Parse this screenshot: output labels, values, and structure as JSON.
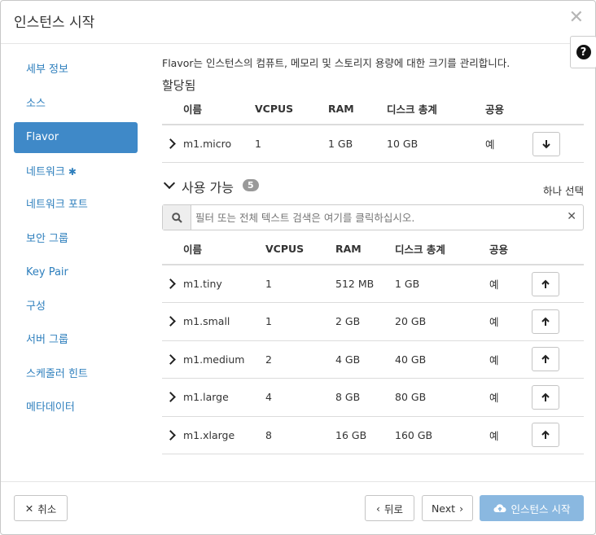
{
  "modal": {
    "title": "인스턴스 시작"
  },
  "nav": {
    "items": [
      {
        "label": "세부 정보"
      },
      {
        "label": "소스"
      },
      {
        "label": "Flavor"
      },
      {
        "label": "네트워크",
        "required": "✱"
      },
      {
        "label": "네트워크 포트"
      },
      {
        "label": "보안 그룹"
      },
      {
        "label": "Key Pair"
      },
      {
        "label": "구성"
      },
      {
        "label": "서버 그룹"
      },
      {
        "label": "스케줄러 힌트"
      },
      {
        "label": "메타데이터"
      }
    ]
  },
  "content": {
    "intro": "Flavor는 인스턴스의 컴퓨트, 메모리 및 스토리지 용량에 대한 크기를 관리합니다.",
    "allocated_title": "할당됨",
    "columns": [
      "이름",
      "VCPUS",
      "RAM",
      "디스크 총계",
      "공용"
    ],
    "allocated_rows": [
      {
        "name": "m1.micro",
        "vcpus": "1",
        "ram": "1 GB",
        "disk": "10 GB",
        "public": "예"
      }
    ],
    "available_title": "사용 가능",
    "available_count": "5",
    "select_one": "하나 선택",
    "filter_placeholder": "필터 또는 전체 텍스트 검색은 여기를 클릭하십시오.",
    "available_rows": [
      {
        "name": "m1.tiny",
        "vcpus": "1",
        "ram": "512 MB",
        "disk": "1 GB",
        "public": "예"
      },
      {
        "name": "m1.small",
        "vcpus": "1",
        "ram": "2 GB",
        "disk": "20 GB",
        "public": "예"
      },
      {
        "name": "m1.medium",
        "vcpus": "2",
        "ram": "4 GB",
        "disk": "40 GB",
        "public": "예"
      },
      {
        "name": "m1.large",
        "vcpus": "4",
        "ram": "8 GB",
        "disk": "80 GB",
        "public": "예"
      },
      {
        "name": "m1.xlarge",
        "vcpus": "8",
        "ram": "16 GB",
        "disk": "160 GB",
        "public": "예"
      }
    ]
  },
  "footer": {
    "cancel": "취소",
    "back": "뒤로",
    "next": "Next",
    "launch": "인스턴스 시작"
  },
  "colors": {
    "accent": "#3f89c8",
    "link": "#2e7fbd",
    "launch_disabled": "#8ab8e0"
  }
}
